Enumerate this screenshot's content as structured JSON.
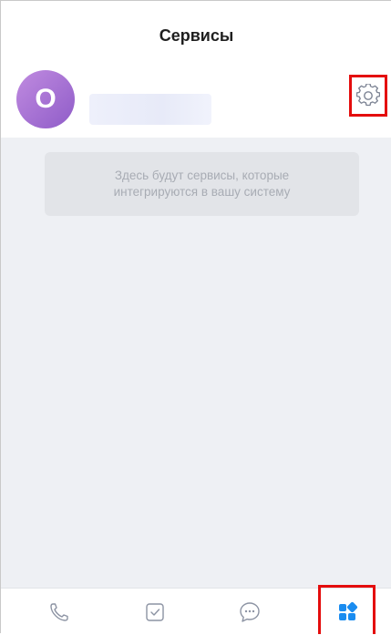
{
  "header": {
    "title": "Сервисы"
  },
  "profile": {
    "avatar_initial": "O",
    "avatar_color": "#a56fd6",
    "settings_icon": "gear-icon"
  },
  "content": {
    "empty_message": "Здесь будут сервисы, которые интегрируются в вашу систему"
  },
  "tabbar": {
    "items": [
      {
        "icon": "phone-icon",
        "active": false
      },
      {
        "icon": "tasks-icon",
        "active": false
      },
      {
        "icon": "chat-icon",
        "active": false
      },
      {
        "icon": "services-icon",
        "active": true
      }
    ],
    "active_color": "#1a8cf0",
    "inactive_color": "#8c93a3"
  },
  "colors": {
    "highlight": "#e40d0d",
    "background": "#eef0f4"
  }
}
